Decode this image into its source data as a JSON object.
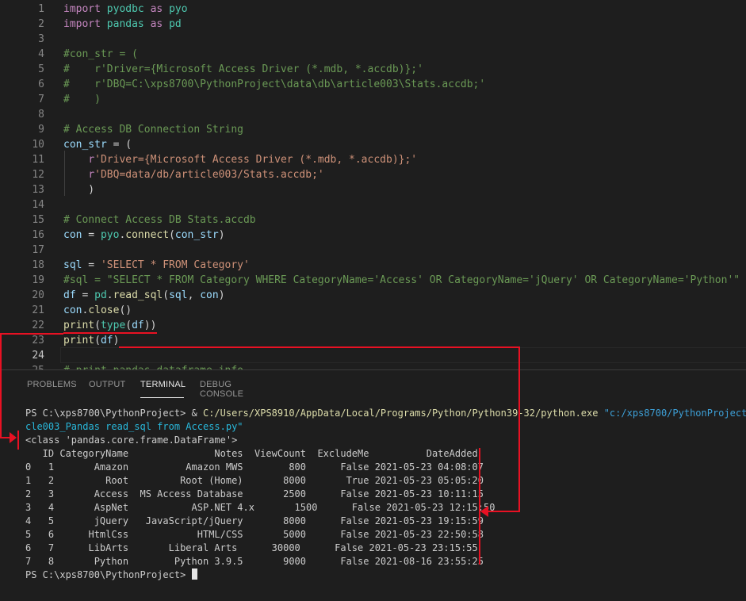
{
  "editor": {
    "lines": [
      {
        "n": "1",
        "tokens": [
          [
            "kw",
            "import"
          ],
          [
            "pl",
            " "
          ],
          [
            "mod",
            "pyodbc"
          ],
          [
            "pl",
            " "
          ],
          [
            "kw",
            "as"
          ],
          [
            "pl",
            " "
          ],
          [
            "mod",
            "pyo"
          ]
        ]
      },
      {
        "n": "2",
        "tokens": [
          [
            "kw",
            "import"
          ],
          [
            "pl",
            " "
          ],
          [
            "mod",
            "pandas"
          ],
          [
            "pl",
            " "
          ],
          [
            "kw",
            "as"
          ],
          [
            "pl",
            " "
          ],
          [
            "mod",
            "pd"
          ]
        ]
      },
      {
        "n": "3",
        "tokens": []
      },
      {
        "n": "4",
        "tokens": [
          [
            "cm",
            "#con_str = ("
          ]
        ]
      },
      {
        "n": "5",
        "tokens": [
          [
            "cm",
            "#    r'Driver={Microsoft Access Driver (*.mdb, *.accdb)};'"
          ]
        ]
      },
      {
        "n": "6",
        "tokens": [
          [
            "cm",
            "#    r'DBQ=C:\\xps8700\\PythonProject\\data\\db\\article003\\Stats.accdb;'"
          ]
        ]
      },
      {
        "n": "7",
        "tokens": [
          [
            "cm",
            "#    )"
          ]
        ]
      },
      {
        "n": "8",
        "tokens": []
      },
      {
        "n": "9",
        "tokens": [
          [
            "cm",
            "# Access DB Connection String"
          ]
        ]
      },
      {
        "n": "10",
        "tokens": [
          [
            "var",
            "con_str"
          ],
          [
            "pl",
            " = ("
          ]
        ]
      },
      {
        "n": "11",
        "tokens": [
          [
            "pl",
            "    "
          ],
          [
            "kw",
            "r"
          ],
          [
            "str",
            "'Driver={Microsoft Access Driver (*.mdb, *.accdb)};'"
          ]
        ]
      },
      {
        "n": "12",
        "tokens": [
          [
            "pl",
            "    "
          ],
          [
            "kw",
            "r"
          ],
          [
            "str",
            "'DBQ=data/db/article003/Stats.accdb;'"
          ]
        ]
      },
      {
        "n": "13",
        "tokens": [
          [
            "pl",
            "    )"
          ]
        ]
      },
      {
        "n": "14",
        "tokens": []
      },
      {
        "n": "15",
        "tokens": [
          [
            "cm",
            "# Connect Access DB Stats.accdb"
          ]
        ]
      },
      {
        "n": "16",
        "tokens": [
          [
            "var",
            "con"
          ],
          [
            "pl",
            " = "
          ],
          [
            "mod",
            "pyo"
          ],
          [
            "pl",
            "."
          ],
          [
            "fn",
            "connect"
          ],
          [
            "pl",
            "("
          ],
          [
            "var",
            "con_str"
          ],
          [
            "pl",
            ")"
          ]
        ]
      },
      {
        "n": "17",
        "tokens": []
      },
      {
        "n": "18",
        "tokens": [
          [
            "var",
            "sql"
          ],
          [
            "pl",
            " = "
          ],
          [
            "str",
            "'SELECT * FROM Category'"
          ]
        ]
      },
      {
        "n": "19",
        "tokens": [
          [
            "cm",
            "#sql = \"SELECT * FROM Category WHERE CategoryName='Access' OR CategoryName='jQuery' OR CategoryName='Python'\""
          ]
        ]
      },
      {
        "n": "20",
        "tokens": [
          [
            "var",
            "df"
          ],
          [
            "pl",
            " = "
          ],
          [
            "mod",
            "pd"
          ],
          [
            "pl",
            "."
          ],
          [
            "fn",
            "read_sql"
          ],
          [
            "pl",
            "("
          ],
          [
            "var",
            "sql"
          ],
          [
            "pl",
            ", "
          ],
          [
            "var",
            "con"
          ],
          [
            "pl",
            ")"
          ]
        ]
      },
      {
        "n": "21",
        "tokens": [
          [
            "var",
            "con"
          ],
          [
            "pl",
            "."
          ],
          [
            "fn",
            "close"
          ],
          [
            "pl",
            "()"
          ]
        ]
      },
      {
        "n": "22",
        "tokens": [
          [
            "fn",
            "print"
          ],
          [
            "pl",
            "("
          ],
          [
            "mod",
            "type"
          ],
          [
            "pl",
            "("
          ],
          [
            "var",
            "df"
          ],
          [
            "pl",
            "))"
          ]
        ]
      },
      {
        "n": "23",
        "tokens": [
          [
            "fn",
            "print"
          ],
          [
            "pl",
            "("
          ],
          [
            "var",
            "df"
          ],
          [
            "pl",
            ")"
          ]
        ]
      },
      {
        "n": "24",
        "tokens": []
      },
      {
        "n": "25",
        "tokens": [
          [
            "cm",
            "# print pandas dataframe info"
          ]
        ]
      }
    ]
  },
  "panel": {
    "tabs": [
      "PROBLEMS",
      "OUTPUT",
      "TERMINAL",
      "DEBUG CONSOLE"
    ],
    "active_tab": "TERMINAL"
  },
  "terminal": {
    "prompt": "PS C:\\xps8700\\PythonProject> ",
    "cmd_prefix": "& ",
    "python_exe": "C:/Users/XPS8910/AppData/Local/Programs/Python/Python39-32/python.exe",
    "script_path_a": " \"c:/xps8700/PythonProject/Arti",
    "script_path_b": "cle003_Pandas read_sql from Access.py\"",
    "type_output": "<class 'pandas.core.frame.DataFrame'>",
    "header": "   ID CategoryName               Notes  ViewCount  ExcludeMe          DateAdded",
    "rows": [
      "0   1       Amazon          Amazon MWS        800      False 2021-05-23 04:08:07",
      "1   2         Root         Root (Home)       8000       True 2021-05-23 05:05:20",
      "2   3       Access  MS Access Database       2500      False 2021-05-23 10:11:15",
      "3   4       AspNet           ASP.NET 4.x       1500      False 2021-05-23 12:15:50",
      "4   5       jQuery   JavaScript/jQuery       8000      False 2021-05-23 19:15:59",
      "5   6      HtmlCss            HTML/CSS       5000      False 2021-05-23 22:50:58",
      "6   7      LibArts       Liberal Arts      30000      False 2021-05-23 23:15:55",
      "7   8       Python        Python 3.9.5       9000      False 2021-08-16 23:55:25"
    ],
    "final_prompt": "PS C:\\xps8700\\PythonProject> "
  },
  "colors": {
    "annotation_arrow": "#e81123"
  }
}
